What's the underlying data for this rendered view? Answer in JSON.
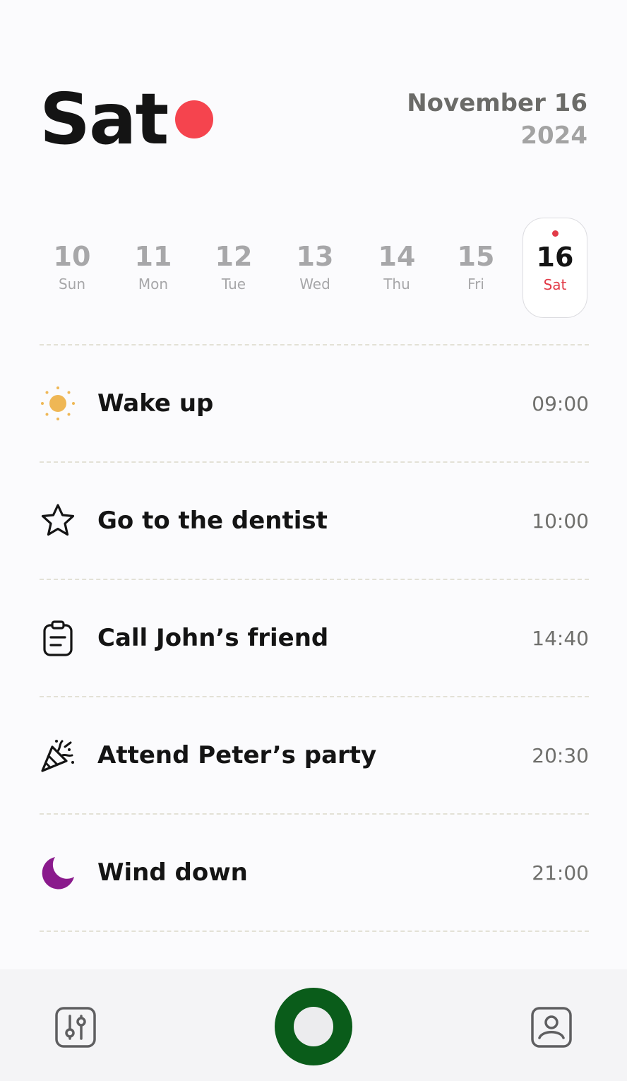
{
  "header": {
    "day": "Sat",
    "month_day": "November 16",
    "year": "2024",
    "dot_color": "#f5444e"
  },
  "week": [
    {
      "num": "10",
      "abbr": "Sun"
    },
    {
      "num": "11",
      "abbr": "Mon"
    },
    {
      "num": "12",
      "abbr": "Tue"
    },
    {
      "num": "13",
      "abbr": "Wed"
    },
    {
      "num": "14",
      "abbr": "Thu"
    },
    {
      "num": "15",
      "abbr": "Fri"
    },
    {
      "num": "16",
      "abbr": "Sat",
      "selected": true
    }
  ],
  "selected_color": "#e23b48",
  "events": [
    {
      "icon": "sun-icon",
      "title": "Wake up",
      "time": "09:00",
      "icon_color": "#efb755"
    },
    {
      "icon": "star-icon",
      "title": "Go to the dentist",
      "time": "10:00",
      "icon_color": "#141414"
    },
    {
      "icon": "clipboard-icon",
      "title": "Call John’s friend",
      "time": "14:40",
      "icon_color": "#141414"
    },
    {
      "icon": "party-popper-icon",
      "title": "Attend Peter’s party",
      "time": "20:30",
      "icon_color": "#141414"
    },
    {
      "icon": "moon-icon",
      "title": "Wind down",
      "time": "21:00",
      "icon_color": "#8a1a8c"
    }
  ],
  "bottom_nav": {
    "left": "settings-sliders-icon",
    "center": "record-button",
    "right": "profile-icon",
    "record_color": "#0a5c1a",
    "icon_color": "#5e5e60"
  }
}
